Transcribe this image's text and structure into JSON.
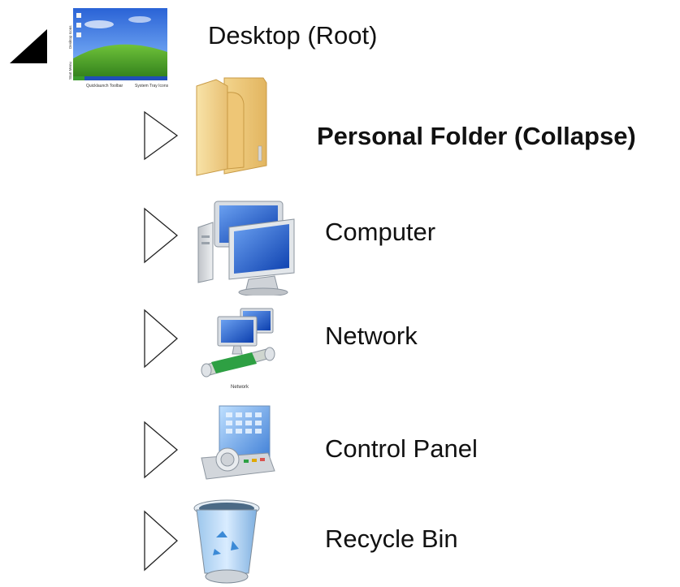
{
  "root": {
    "label": "Desktop (Root)",
    "expanded": true,
    "icon": "desktop-wallpaper-icon",
    "thumb": {
      "side_left": "Desktop Icons",
      "side_left2": "Start Menu",
      "bottom_left": "Quicklaunch Toolbar",
      "bottom_right": "System Tray Icons"
    }
  },
  "items": [
    {
      "label": "Personal Folder (Collapse)",
      "bold": true,
      "icon": "folder-icon",
      "expanded": false
    },
    {
      "label": "Computer",
      "bold": false,
      "icon": "computer-icon",
      "expanded": false
    },
    {
      "label": "Network",
      "bold": false,
      "icon": "network-icon",
      "icon_caption": "Network",
      "expanded": false
    },
    {
      "label": "Control Panel",
      "bold": false,
      "icon": "control-panel-icon",
      "expanded": false
    },
    {
      "label": "Recycle Bin",
      "bold": false,
      "icon": "recycle-bin-icon",
      "expanded": false
    }
  ]
}
